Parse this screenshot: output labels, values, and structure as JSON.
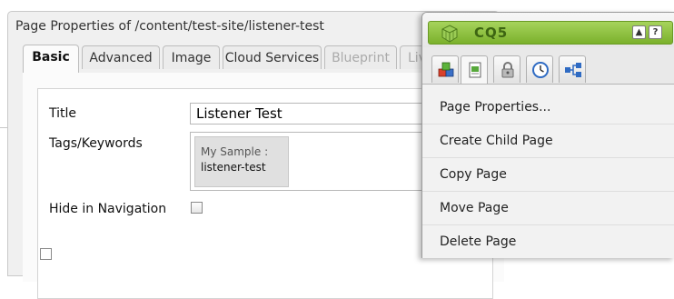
{
  "dialog": {
    "title": "Page Properties of /content/test-site/listener-test",
    "tabs": [
      {
        "label": "Basic"
      },
      {
        "label": "Advanced"
      },
      {
        "label": "Image"
      },
      {
        "label": "Cloud Services"
      },
      {
        "label": "Blueprint"
      },
      {
        "label": "Liv"
      }
    ],
    "fields": {
      "title_label": "Title",
      "title_value": "Listener Test",
      "tags_label": "Tags/Keywords",
      "tag_namespace": "My Sample :",
      "tag_name": "listener-test",
      "hide_nav_label": "Hide in Navigation"
    }
  },
  "sidekick": {
    "title": "CQ5",
    "collapse_glyph": "▲",
    "help_glyph": "?",
    "tab_icons": [
      "components-icon",
      "page-icon",
      "lock-icon",
      "clock-icon",
      "workflow-icon"
    ],
    "menu": [
      {
        "label": "Page Properties..."
      },
      {
        "label": "Create Child Page"
      },
      {
        "label": "Copy Page"
      },
      {
        "label": "Move Page"
      },
      {
        "label": "Delete Page"
      }
    ],
    "colors": {
      "accent": "#8bc13e",
      "accent_dark": "#6a9a25"
    }
  }
}
